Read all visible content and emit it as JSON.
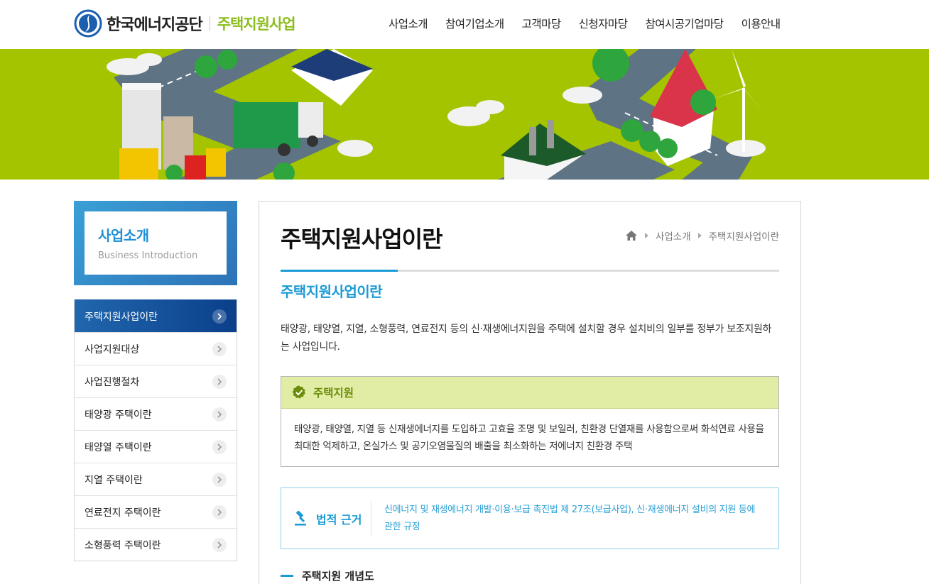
{
  "header": {
    "org_name": "한국에너지공단",
    "site_name": "주택지원사업",
    "nav": [
      "사업소개",
      "참여기업소개",
      "고객마당",
      "신청자마당",
      "참여시공기업마당",
      "이용안내"
    ]
  },
  "sidebar": {
    "title": "사업소개",
    "title_en": "Business Introduction",
    "items": [
      {
        "label": "주택지원사업이란",
        "active": true
      },
      {
        "label": "사업지원대상"
      },
      {
        "label": "사업진행절차"
      },
      {
        "label": "태양광 주택이란"
      },
      {
        "label": "태양열 주택이란"
      },
      {
        "label": "지열 주택이란"
      },
      {
        "label": "연료전지 주택이란"
      },
      {
        "label": "소형풍력 주택이란"
      }
    ]
  },
  "main": {
    "page_title": "주택지원사업이란",
    "breadcrumb": [
      "사업소개",
      "주택지원사업이란"
    ],
    "section_title": "주택지원사업이란",
    "intro": "태양광, 태양열, 지열, 소형풍력, 연료전지 등의 신·재생에너지원을 주택에 설치할 경우 설치비의 일부를 정부가 보조지원하는 사업입니다.",
    "support_box": {
      "title": "주택지원",
      "body": "태양광, 태양열, 지열 등 신재생에너지를 도입하고 고효율 조명 및 보일러, 친환경 단열재를 사용함으로써 화석연료 사용을 최대한 억제하고, 온실가스 및 공기오염물질의 배출을 최소화하는 저에너지 친환경 주택"
    },
    "legal_box": {
      "title": "법적 근거",
      "body": "신에너지 및 재생에너지 개발·이용·보급 촉진법 제 27조(보급사업), 신·재생에너지 설비의 지원 등에 관한 규정"
    },
    "subhead": "주택지원 개념도"
  },
  "colors": {
    "brand_green": "#8cbd1e",
    "accent_blue": "#1a9ad6",
    "banner_bg": "#a4c400",
    "sidebar_active": "#2167ae"
  }
}
